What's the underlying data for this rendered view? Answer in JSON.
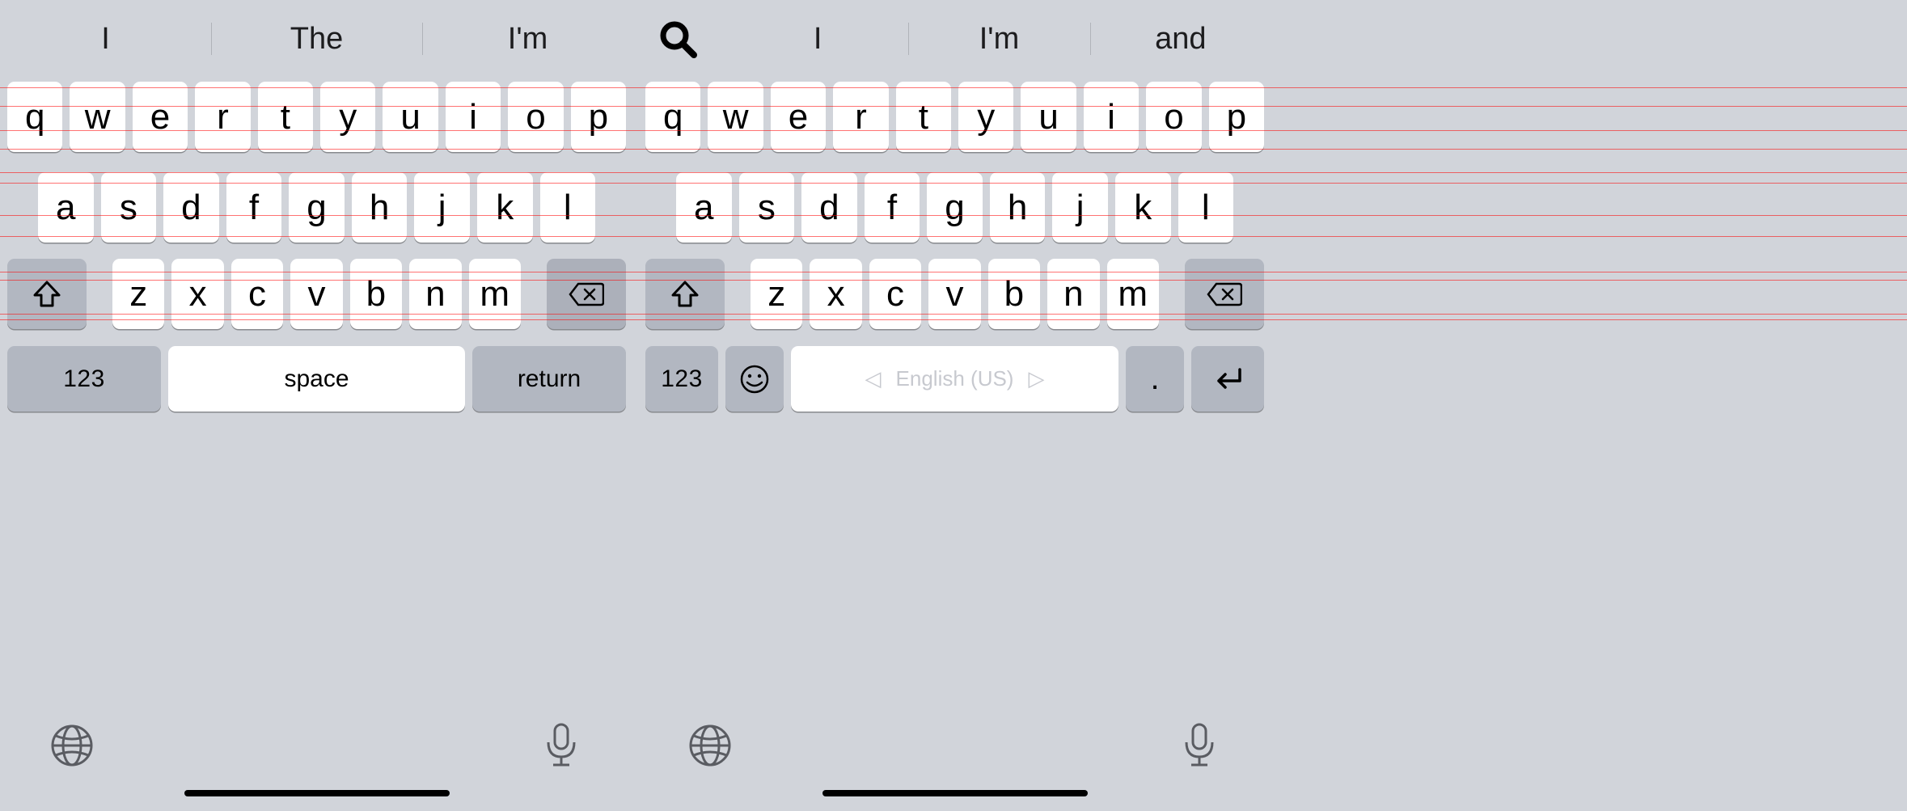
{
  "left": {
    "suggestions": [
      "I",
      "The",
      "I'm"
    ],
    "row1": [
      "q",
      "w",
      "e",
      "r",
      "t",
      "y",
      "u",
      "i",
      "o",
      "p"
    ],
    "row2": [
      "a",
      "s",
      "d",
      "f",
      "g",
      "h",
      "j",
      "k",
      "l"
    ],
    "row3": [
      "z",
      "x",
      "c",
      "v",
      "b",
      "n",
      "m"
    ],
    "numbers_label": "123",
    "space_label": "space",
    "return_label": "return"
  },
  "right": {
    "suggestions": [
      "I",
      "I'm",
      "and"
    ],
    "row1": [
      "q",
      "w",
      "e",
      "r",
      "t",
      "y",
      "u",
      "i",
      "o",
      "p"
    ],
    "row2": [
      "a",
      "s",
      "d",
      "f",
      "g",
      "h",
      "j",
      "k",
      "l"
    ],
    "row3": [
      "z",
      "x",
      "c",
      "v",
      "b",
      "n",
      "m"
    ],
    "numbers_label": "123",
    "language_label": "English (US)",
    "dot_label": "."
  },
  "stripes_y": [
    108,
    131,
    161,
    184,
    213,
    226,
    266,
    292,
    336,
    346,
    388,
    395
  ]
}
